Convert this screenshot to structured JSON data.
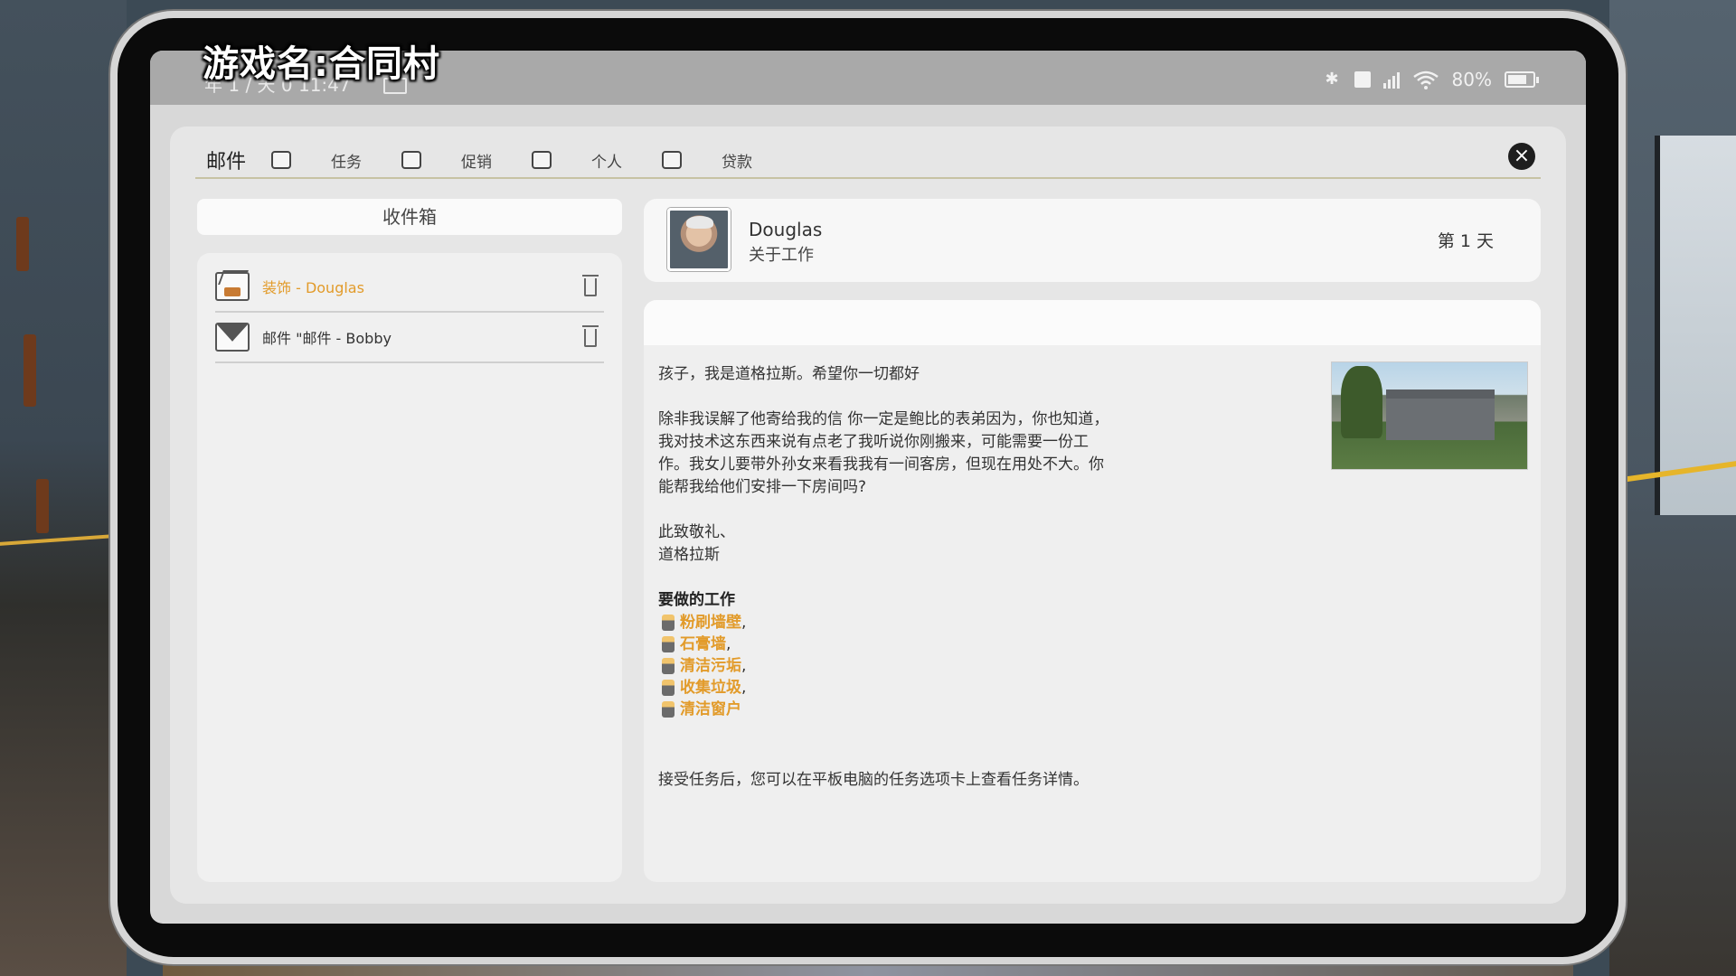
{
  "stream_title": "游戏名:合同村",
  "statusbar": {
    "datetime": "年 1 / 天 0   11:47",
    "battery": "80%"
  },
  "tabs": {
    "title": "邮件",
    "items": [
      {
        "label": "任务"
      },
      {
        "label": "促销"
      },
      {
        "label": "个人"
      },
      {
        "label": "贷款"
      }
    ]
  },
  "inbox": {
    "header": "收件箱",
    "items": [
      {
        "subject": "装饰 - Douglas",
        "unread": true,
        "icon": "house-mail-icon"
      },
      {
        "subject": "邮件 \"邮件 - Bobby",
        "unread": false,
        "icon": "envelope-icon"
      }
    ]
  },
  "message": {
    "sender": "Douglas",
    "subject": "关于工作",
    "day": "第 1 天",
    "greeting": "孩子，我是道格拉斯。希望你一切都好",
    "paragraph": "除非我误解了他寄给我的信 你一定是鲍比的表弟因为，你也知道，我对技术这东西来说有点老了我听说你刚搬来，可能需要一份工作。我女儿要带外孙女来看我我有一间客房，但现在用处不大。你能帮我给他们安排一下房间吗?",
    "signoff_1": "此致敬礼、",
    "signoff_2": "道格拉斯",
    "jobs_title": "要做的工作",
    "jobs": [
      {
        "label": "粉刷墙壁",
        "comma": ","
      },
      {
        "label": "石膏墙",
        "comma": ","
      },
      {
        "label": "清洁污垢",
        "comma": ","
      },
      {
        "label": "收集垃圾",
        "comma": ","
      },
      {
        "label": "清洁窗户",
        "comma": ""
      }
    ],
    "footer": "接受任务后，您可以在平板电脑的任务选项卡上查看任务详情。"
  },
  "colors": {
    "accent": "#e29b2a",
    "close": "#1e1e1e"
  }
}
